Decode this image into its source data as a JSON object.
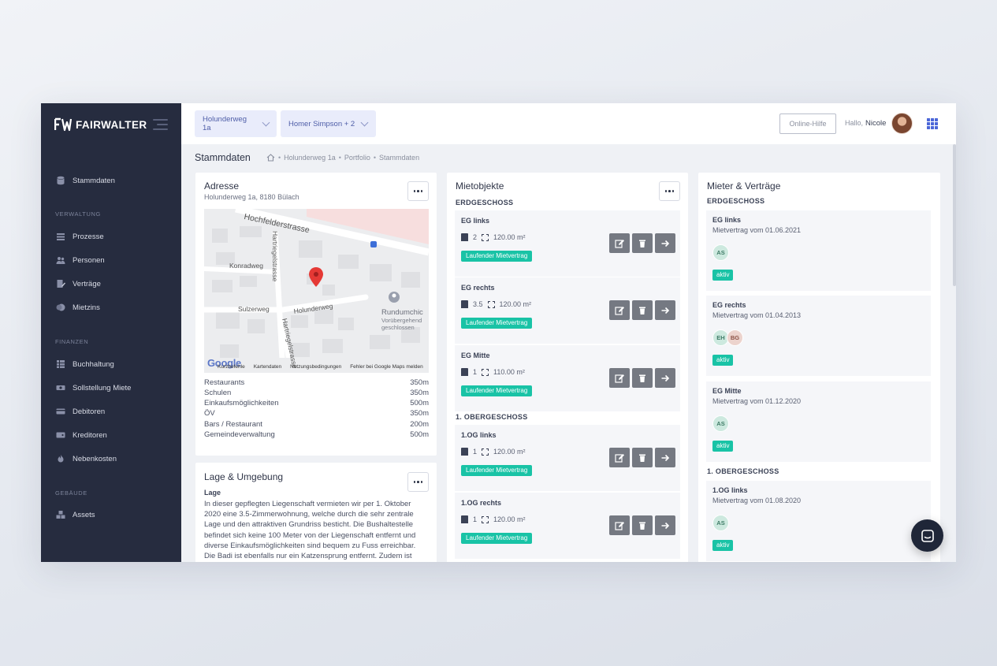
{
  "app": {
    "brand": "FAIRWALTER"
  },
  "sidebar": {
    "main_item": "Stammdaten",
    "sections": [
      {
        "label": "VERWALTUNG",
        "items": [
          "Prozesse",
          "Personen",
          "Verträge",
          "Mietzins"
        ]
      },
      {
        "label": "FINANZEN",
        "items": [
          "Buchhaltung",
          "Sollstellung Miete",
          "Debitoren",
          "Kreditoren",
          "Nebenkosten"
        ]
      },
      {
        "label": "GEBÄUDE",
        "items": [
          "Assets"
        ]
      }
    ]
  },
  "topbar": {
    "property_select": "Holunderweg 1a",
    "person_select": "Homer Simpson + 2",
    "help_button": "Online-Hilfe",
    "greeting": "Hallo,",
    "user_name": "Nicole"
  },
  "page": {
    "title": "Stammdaten",
    "breadcrumb": [
      "Holunderweg 1a",
      "Portfolio",
      "Stammdaten"
    ]
  },
  "address_card": {
    "title": "Adresse",
    "address": "Holunderweg 1a, 8180 Bülach",
    "map": {
      "streets": [
        "Hochfelderstrasse",
        "Hartriegelstrasse",
        "Konradweg",
        "Sulzerweg",
        "Holunderweg",
        "Hartriegelstrasse"
      ],
      "poi_name": "Rundumchic",
      "poi_status_1": "Vorübergehend",
      "poi_status_2": "geschlossen",
      "logo": "Google",
      "footer": [
        "Kurzbefehle",
        "Kartendaten",
        "Nutzungsbedingungen",
        "Fehler bei Google Maps melden"
      ]
    },
    "amenities": [
      {
        "name": "Restaurants",
        "distance": "350m"
      },
      {
        "name": "Schulen",
        "distance": "350m"
      },
      {
        "name": "Einkaufsmöglichkeiten",
        "distance": "500m"
      },
      {
        "name": "ÖV",
        "distance": "350m"
      },
      {
        "name": "Bars / Restaurant",
        "distance": "200m"
      },
      {
        "name": "Gemeindeverwaltung",
        "distance": "500m"
      }
    ]
  },
  "lage_card": {
    "title": "Lage & Umgebung",
    "subheading": "Lage",
    "text": "In dieser gepflegten Liegenschaft vermieten wir per 1. Oktober 2020 eine 3.5-Zimmerwohnung, welche durch die sehr zentrale Lage und den attraktiven Grundriss besticht. Die Bushaltestelle befindet sich keine 100 Meter von der Liegenschaft entfernt und diverse Einkaufsmöglichkeiten sind bequem zu Fuss erreichbar. Die Badi ist ebenfalls nur ein Katzensprung entfernt. Zudem ist"
  },
  "mietobjekte_card": {
    "title": "Mietobjekte",
    "floors": [
      {
        "label": "ERDGESCHOSS",
        "units": [
          {
            "name": "EG links",
            "rooms": "2",
            "area": "120.00 m²",
            "status": "Laufender Mietvertrag"
          },
          {
            "name": "EG rechts",
            "rooms": "3.5",
            "area": "120.00 m²",
            "status": "Laufender Mietvertrag"
          },
          {
            "name": "EG Mitte",
            "rooms": "1",
            "area": "110.00 m²",
            "status": "Laufender Mietvertrag"
          }
        ]
      },
      {
        "label": "1. OBERGESCHOSS",
        "units": [
          {
            "name": "1.OG links",
            "rooms": "1",
            "area": "120.00 m²",
            "status": "Laufender Mietvertrag"
          },
          {
            "name": "1.OG rechts",
            "rooms": "1",
            "area": "120.00 m²",
            "status": "Laufender Mietvertrag"
          }
        ]
      }
    ]
  },
  "mieter_card": {
    "title": "Mieter & Verträge",
    "floors": [
      {
        "label": "ERDGESCHOSS",
        "entries": [
          {
            "name": "EG links",
            "contract": "Mietvertrag vom 01.06.2021",
            "tenants": [
              "AS"
            ],
            "status": "aktiv"
          },
          {
            "name": "EG rechts",
            "contract": "Mietvertrag vom 01.04.2013",
            "tenants": [
              "EH",
              "BG"
            ],
            "status": "aktiv"
          },
          {
            "name": "EG Mitte",
            "contract": "Mietvertrag vom 01.12.2020",
            "tenants": [
              "AS"
            ],
            "status": "aktiv"
          }
        ]
      },
      {
        "label": "1. OBERGESCHOSS",
        "entries": [
          {
            "name": "1.OG links",
            "contract": "Mietvertrag vom 01.08.2020",
            "tenants": [
              "AS"
            ],
            "status": "aktiv"
          }
        ]
      }
    ]
  },
  "colors": {
    "sidebar": "#262c3f",
    "accent": "#4b66d8",
    "badge": "#19c3a6",
    "action": "#757982"
  }
}
